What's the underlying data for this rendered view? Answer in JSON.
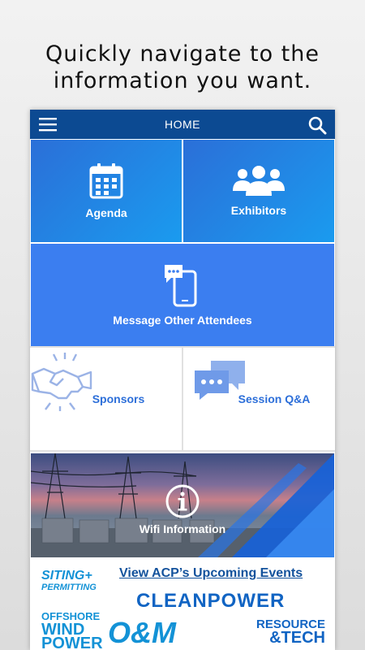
{
  "headline": {
    "line1": "Quickly navigate to the",
    "line2": "information you want."
  },
  "topbar": {
    "title": "HOME",
    "menu_icon": "hamburger-menu-icon",
    "search_icon": "search-icon",
    "color": "#0c4a92"
  },
  "tiles": {
    "agenda": {
      "label": "Agenda",
      "icon": "calendar-icon"
    },
    "exhibitors": {
      "label": "Exhibitors",
      "icon": "group-people-icon"
    },
    "message": {
      "label": "Message Other Attendees",
      "icon": "phone-chat-icon"
    },
    "sponsors": {
      "label": "Sponsors",
      "icon": "handshake-icon"
    },
    "session": {
      "label": "Session Q&A",
      "icon": "chat-bubbles-icon"
    },
    "wifi": {
      "label": "Wifi Information",
      "icon": "info-circle-icon"
    }
  },
  "events": {
    "link": "View ACP’s Upcoming Events",
    "siting_line1": "SITING",
    "siting_plus": "+",
    "siting_line2": "PERMITTING",
    "cleanpower": "CLEANPOWER",
    "offshore_line1": "OFFSHORE",
    "offshore_line2": "WIND",
    "offshore_line3": "POWER",
    "om": "O&M",
    "resource_line1": "RESOURCE",
    "resource_line2": "&TECH"
  },
  "colors": {
    "accent_blue": "#3b7ef0",
    "tile_text_blue": "#2d6fd9"
  }
}
